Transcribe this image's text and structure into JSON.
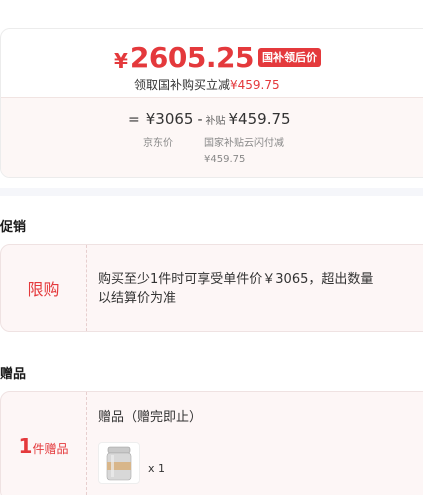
{
  "price": {
    "symbol": "¥",
    "value": "2605.25",
    "badge": "国补领后价",
    "subtitle_prefix": "领取国补购买立减",
    "subtitle_amount": "¥459.75"
  },
  "breakdown": {
    "equals": "=",
    "jd_price": "¥3065",
    "minus": "-",
    "subsidy_label": "补贴",
    "subsidy_amount": "¥459.75",
    "jd_caption": "京东价",
    "subsidy_caption": "国家补贴云闪付减",
    "subsidy_caption_amount": "¥459.75"
  },
  "promotion": {
    "section_title": "促销",
    "tag": "限购",
    "text": "购买至少1件时可享受单件价￥3065，超出数量以结算价为准"
  },
  "gift": {
    "section_title": "赠品",
    "count": "1",
    "count_unit": "件赠品",
    "title": "赠品（赠完即止）",
    "quantity": "x 1"
  },
  "colors": {
    "accent": "#e4393c",
    "card_bg": "#fdf6f6"
  }
}
